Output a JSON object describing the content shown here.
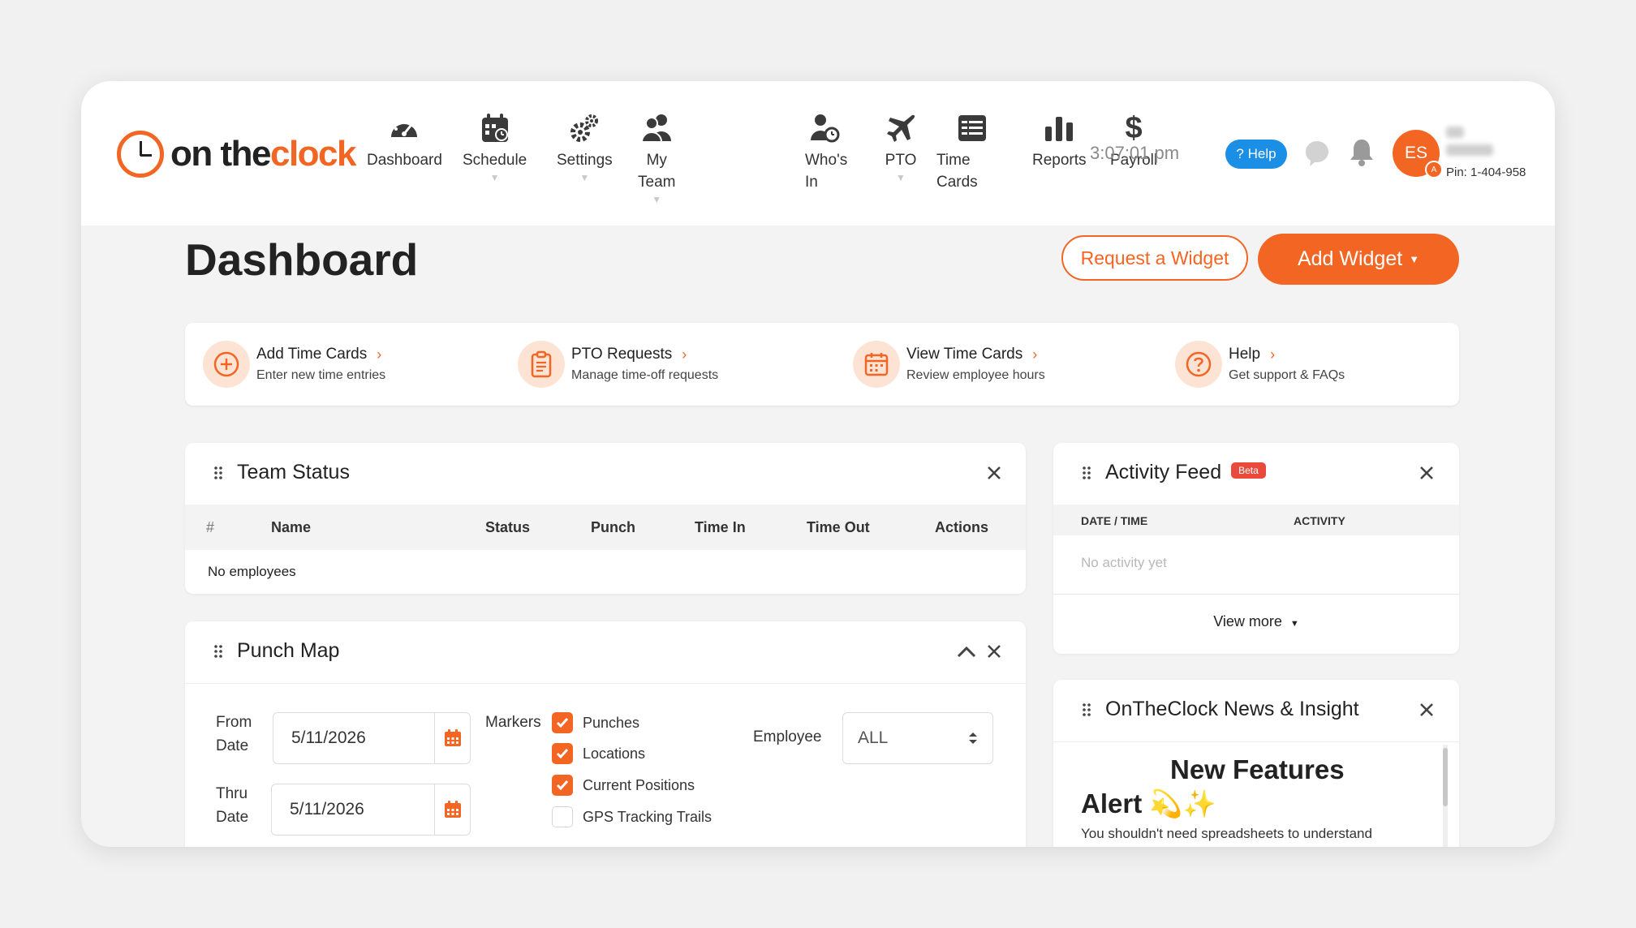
{
  "brand": {
    "name_part1": "on the",
    "name_part2": "clock"
  },
  "nav": [
    {
      "label": "Dashboard",
      "icon": "dashboard-gauge-icon",
      "has_caret": false
    },
    {
      "label": "Schedule",
      "icon": "schedule-calendar-icon",
      "has_caret": true
    },
    {
      "label": "Settings",
      "icon": "settings-gears-icon",
      "has_caret": true
    },
    {
      "label": "My Team",
      "icon": "team-users-icon",
      "has_caret": true
    },
    {
      "label": "Who's In",
      "icon": "whos-in-user-clock-icon",
      "has_caret": false
    },
    {
      "label": "PTO",
      "icon": "pto-plane-icon",
      "has_caret": true
    },
    {
      "label": "Time Cards",
      "icon": "time-cards-table-icon",
      "has_caret": false
    },
    {
      "label": "Reports",
      "icon": "reports-bar-chart-icon",
      "has_caret": false
    },
    {
      "label": "Payroll",
      "icon": "payroll-dollar-icon",
      "has_caret": false
    }
  ],
  "header": {
    "time": "3:07:01 pm",
    "help_label": "? Help",
    "avatar_initials": "ES",
    "avatar_badge": "A",
    "pin": "Pin: 1-404-958"
  },
  "page": {
    "title": "Dashboard",
    "request_widget": "Request a Widget",
    "add_widget": "Add Widget"
  },
  "quick_links": [
    {
      "title": "Add Time Cards",
      "subtitle": "Enter new time entries",
      "icon": "plus-circle-icon"
    },
    {
      "title": "PTO Requests",
      "subtitle": "Manage time-off requests",
      "icon": "clipboard-icon"
    },
    {
      "title": "View Time Cards",
      "subtitle": "Review employee hours",
      "icon": "calendar-icon"
    },
    {
      "title": "Help",
      "subtitle": "Get support & FAQs",
      "icon": "question-circle-icon"
    }
  ],
  "team_status": {
    "title": "Team Status",
    "columns": [
      "#",
      "Name",
      "Status",
      "Punch",
      "Time In",
      "Time Out",
      "Actions"
    ],
    "empty": "No employees"
  },
  "activity_feed": {
    "title": "Activity Feed",
    "badge": "Beta",
    "columns": [
      "DATE / TIME",
      "ACTIVITY"
    ],
    "empty": "No activity yet",
    "view_more": "View more"
  },
  "punch_map": {
    "title": "Punch Map",
    "from_label": "From Date",
    "from_value": "5/11/2026",
    "thru_label": "Thru Date",
    "thru_value": "5/11/2026",
    "markers_label": "Markers",
    "markers": [
      {
        "label": "Punches",
        "checked": true
      },
      {
        "label": "Locations",
        "checked": true
      },
      {
        "label": "Current Positions",
        "checked": true
      },
      {
        "label": "GPS Tracking Trails",
        "checked": false
      }
    ],
    "employee_label": "Employee",
    "employee_value": "ALL"
  },
  "news": {
    "title": "OnTheClock News & Insight",
    "headline": "New Features Alert 💫✨",
    "body": "You shouldn't need spreadsheets to understand"
  },
  "colors": {
    "accent": "#f26522",
    "help_blue": "#1b8fe6",
    "beta_red": "#e94a3b"
  }
}
